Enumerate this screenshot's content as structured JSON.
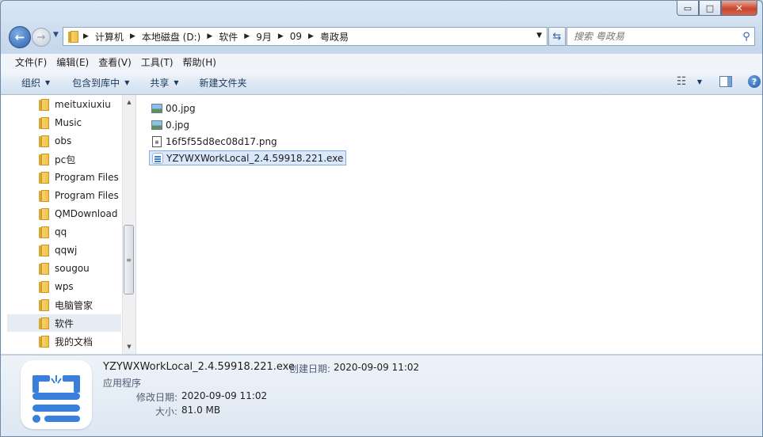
{
  "window": {
    "title_buttons": {
      "minimize": "▭",
      "maximize": "□",
      "close": "✕"
    }
  },
  "nav": {
    "back_glyph": "←",
    "forward_glyph": "→",
    "breadcrumbs": [
      "计算机",
      "本地磁盘 (D:)",
      "软件",
      "9月",
      "09",
      "粤政易"
    ],
    "refresh_glyph": "⇆",
    "search_placeholder": "搜索 粤政易"
  },
  "menubar": [
    "文件(F)",
    "编辑(E)",
    "查看(V)",
    "工具(T)",
    "帮助(H)"
  ],
  "toolbar": {
    "organize": "组织",
    "include_in_library": "包含到库中",
    "share": "共享",
    "new_folder": "新建文件夹",
    "help_glyph": "?"
  },
  "tree": [
    {
      "label": "meituxiuxiu"
    },
    {
      "label": "Music"
    },
    {
      "label": "obs"
    },
    {
      "label": "pc包"
    },
    {
      "label": "Program Files"
    },
    {
      "label": "Program Files"
    },
    {
      "label": "QMDownload"
    },
    {
      "label": "qq"
    },
    {
      "label": "qqwj"
    },
    {
      "label": "sougou"
    },
    {
      "label": "wps"
    },
    {
      "label": "电脑管家"
    },
    {
      "label": "软件",
      "selected": true
    },
    {
      "label": "我的文档"
    }
  ],
  "files": [
    {
      "name": "00.jpg",
      "icon": "image-icon"
    },
    {
      "name": "0.jpg",
      "icon": "image-icon"
    },
    {
      "name": "16f5f55d8ec08d17.png",
      "icon": "png-icon"
    },
    {
      "name": "YZYWXWorkLocal_2.4.59918.221.exe",
      "icon": "exe-icon",
      "selected": true
    }
  ],
  "details": {
    "filename": "YZYWXWorkLocal_2.4.59918.221.exe",
    "created_label": "创建日期:",
    "created_value": "2020-09-09 11:02",
    "type": "应用程序",
    "modified_label": "修改日期:",
    "modified_value": "2020-09-09 11:02",
    "size_label": "大小:",
    "size_value": "81.0 MB"
  },
  "colors": {
    "exe_icon_blue": "#3a7fdc",
    "selection": "#d9e8fb"
  }
}
